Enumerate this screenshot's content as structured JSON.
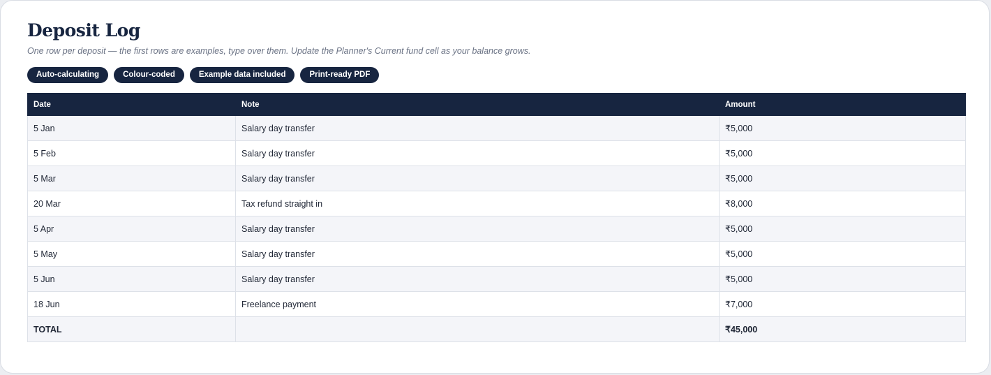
{
  "page": {
    "title": "Deposit Log",
    "subtitle": "One row per deposit — the first rows are examples, type over them. Update the Planner's Current fund cell as your balance grows."
  },
  "badges": [
    "Auto-calculating",
    "Colour-coded",
    "Example data included",
    "Print-ready PDF"
  ],
  "table": {
    "columns": [
      "Date",
      "Note",
      "Amount"
    ],
    "rows": [
      {
        "date": "5 Jan",
        "note": "Salary day transfer",
        "amount": "₹5,000"
      },
      {
        "date": "5 Feb",
        "note": "Salary day transfer",
        "amount": "₹5,000"
      },
      {
        "date": "5 Mar",
        "note": "Salary day transfer",
        "amount": "₹5,000"
      },
      {
        "date": "20 Mar",
        "note": "Tax refund straight in",
        "amount": "₹8,000"
      },
      {
        "date": "5 Apr",
        "note": "Salary day transfer",
        "amount": "₹5,000"
      },
      {
        "date": "5 May",
        "note": "Salary day transfer",
        "amount": "₹5,000"
      },
      {
        "date": "5 Jun",
        "note": "Salary day transfer",
        "amount": "₹5,000"
      },
      {
        "date": "18 Jun",
        "note": "Freelance payment",
        "amount": "₹7,000"
      }
    ],
    "total": {
      "label": "TOTAL",
      "note": "",
      "amount": "₹45,000"
    }
  },
  "colors": {
    "navy": "#172540",
    "row_alt": "#f4f5f9",
    "border": "#dde1e8"
  }
}
